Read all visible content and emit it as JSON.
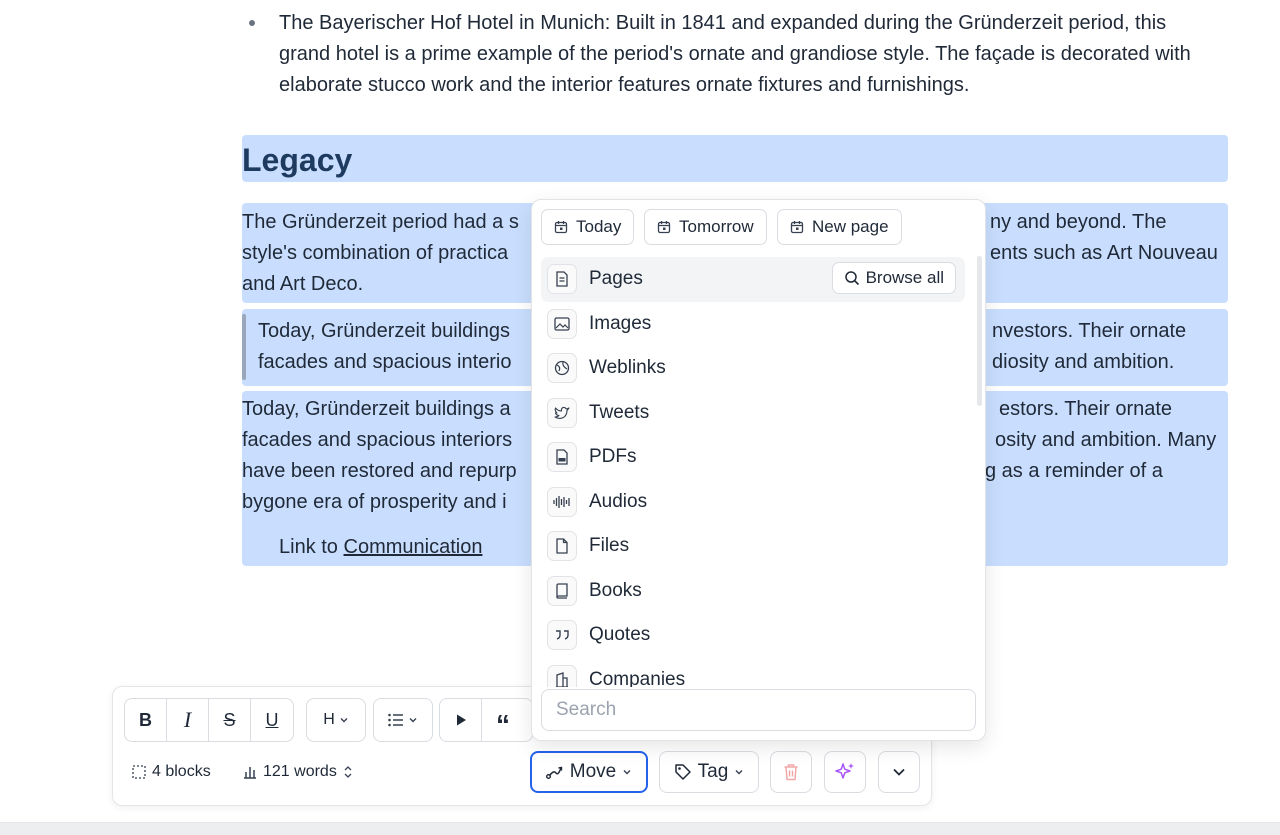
{
  "document": {
    "bullet": "The Bayerischer Hof Hotel in Munich: Built in 1841 and expanded during the Gründerzeit period, this grand hotel is a prime example of the period's ornate and grandiose style. The façade is decorated with elaborate stucco work and the interior features ornate fixtures and furnishings.",
    "heading": "Legacy",
    "para1": {
      "l1a": "The Gründerzeit period had a s",
      "l1b": "ny and beyond. The",
      "l2a": "style's combination of practica",
      "l2b": "ents such as Art Nouveau",
      "l3a": "and Art Deco."
    },
    "quote": {
      "l1a": "Today, Gründerzeit buildings",
      "l1b": "nvestors. Their ornate",
      "l2a": "facades and spacious interio",
      "l2b": "diosity and ambition."
    },
    "para3": {
      "l1a": "Today, Gründerzeit buildings a",
      "l1b": "estors. Their ornate",
      "l2a": "facades and spacious interiors",
      "l2b": "osity and ambition. Many",
      "l3a": "have been restored and repurp",
      "l3b": "g as a reminder of a",
      "l4a": "bygone era of prosperity and i"
    },
    "link_prefix": "Link to",
    "link_text": "Communication"
  },
  "menu": {
    "chips": [
      "Today",
      "Tomorrow",
      "New page"
    ],
    "browse_all": "Browse all",
    "items": [
      "Pages",
      "Images",
      "Weblinks",
      "Tweets",
      "PDFs",
      "Audios",
      "Files",
      "Books",
      "Quotes",
      "Companies"
    ],
    "search_placeholder": "Search"
  },
  "toolbar": {
    "heading_label": "H",
    "blocks": "4 blocks",
    "words": "121 words",
    "move": "Move",
    "tag": "Tag"
  },
  "colors": {
    "selection": "#c9defe",
    "focus": "#2563eb",
    "delete": "#f2a7a7",
    "ai": "#a855f7"
  }
}
